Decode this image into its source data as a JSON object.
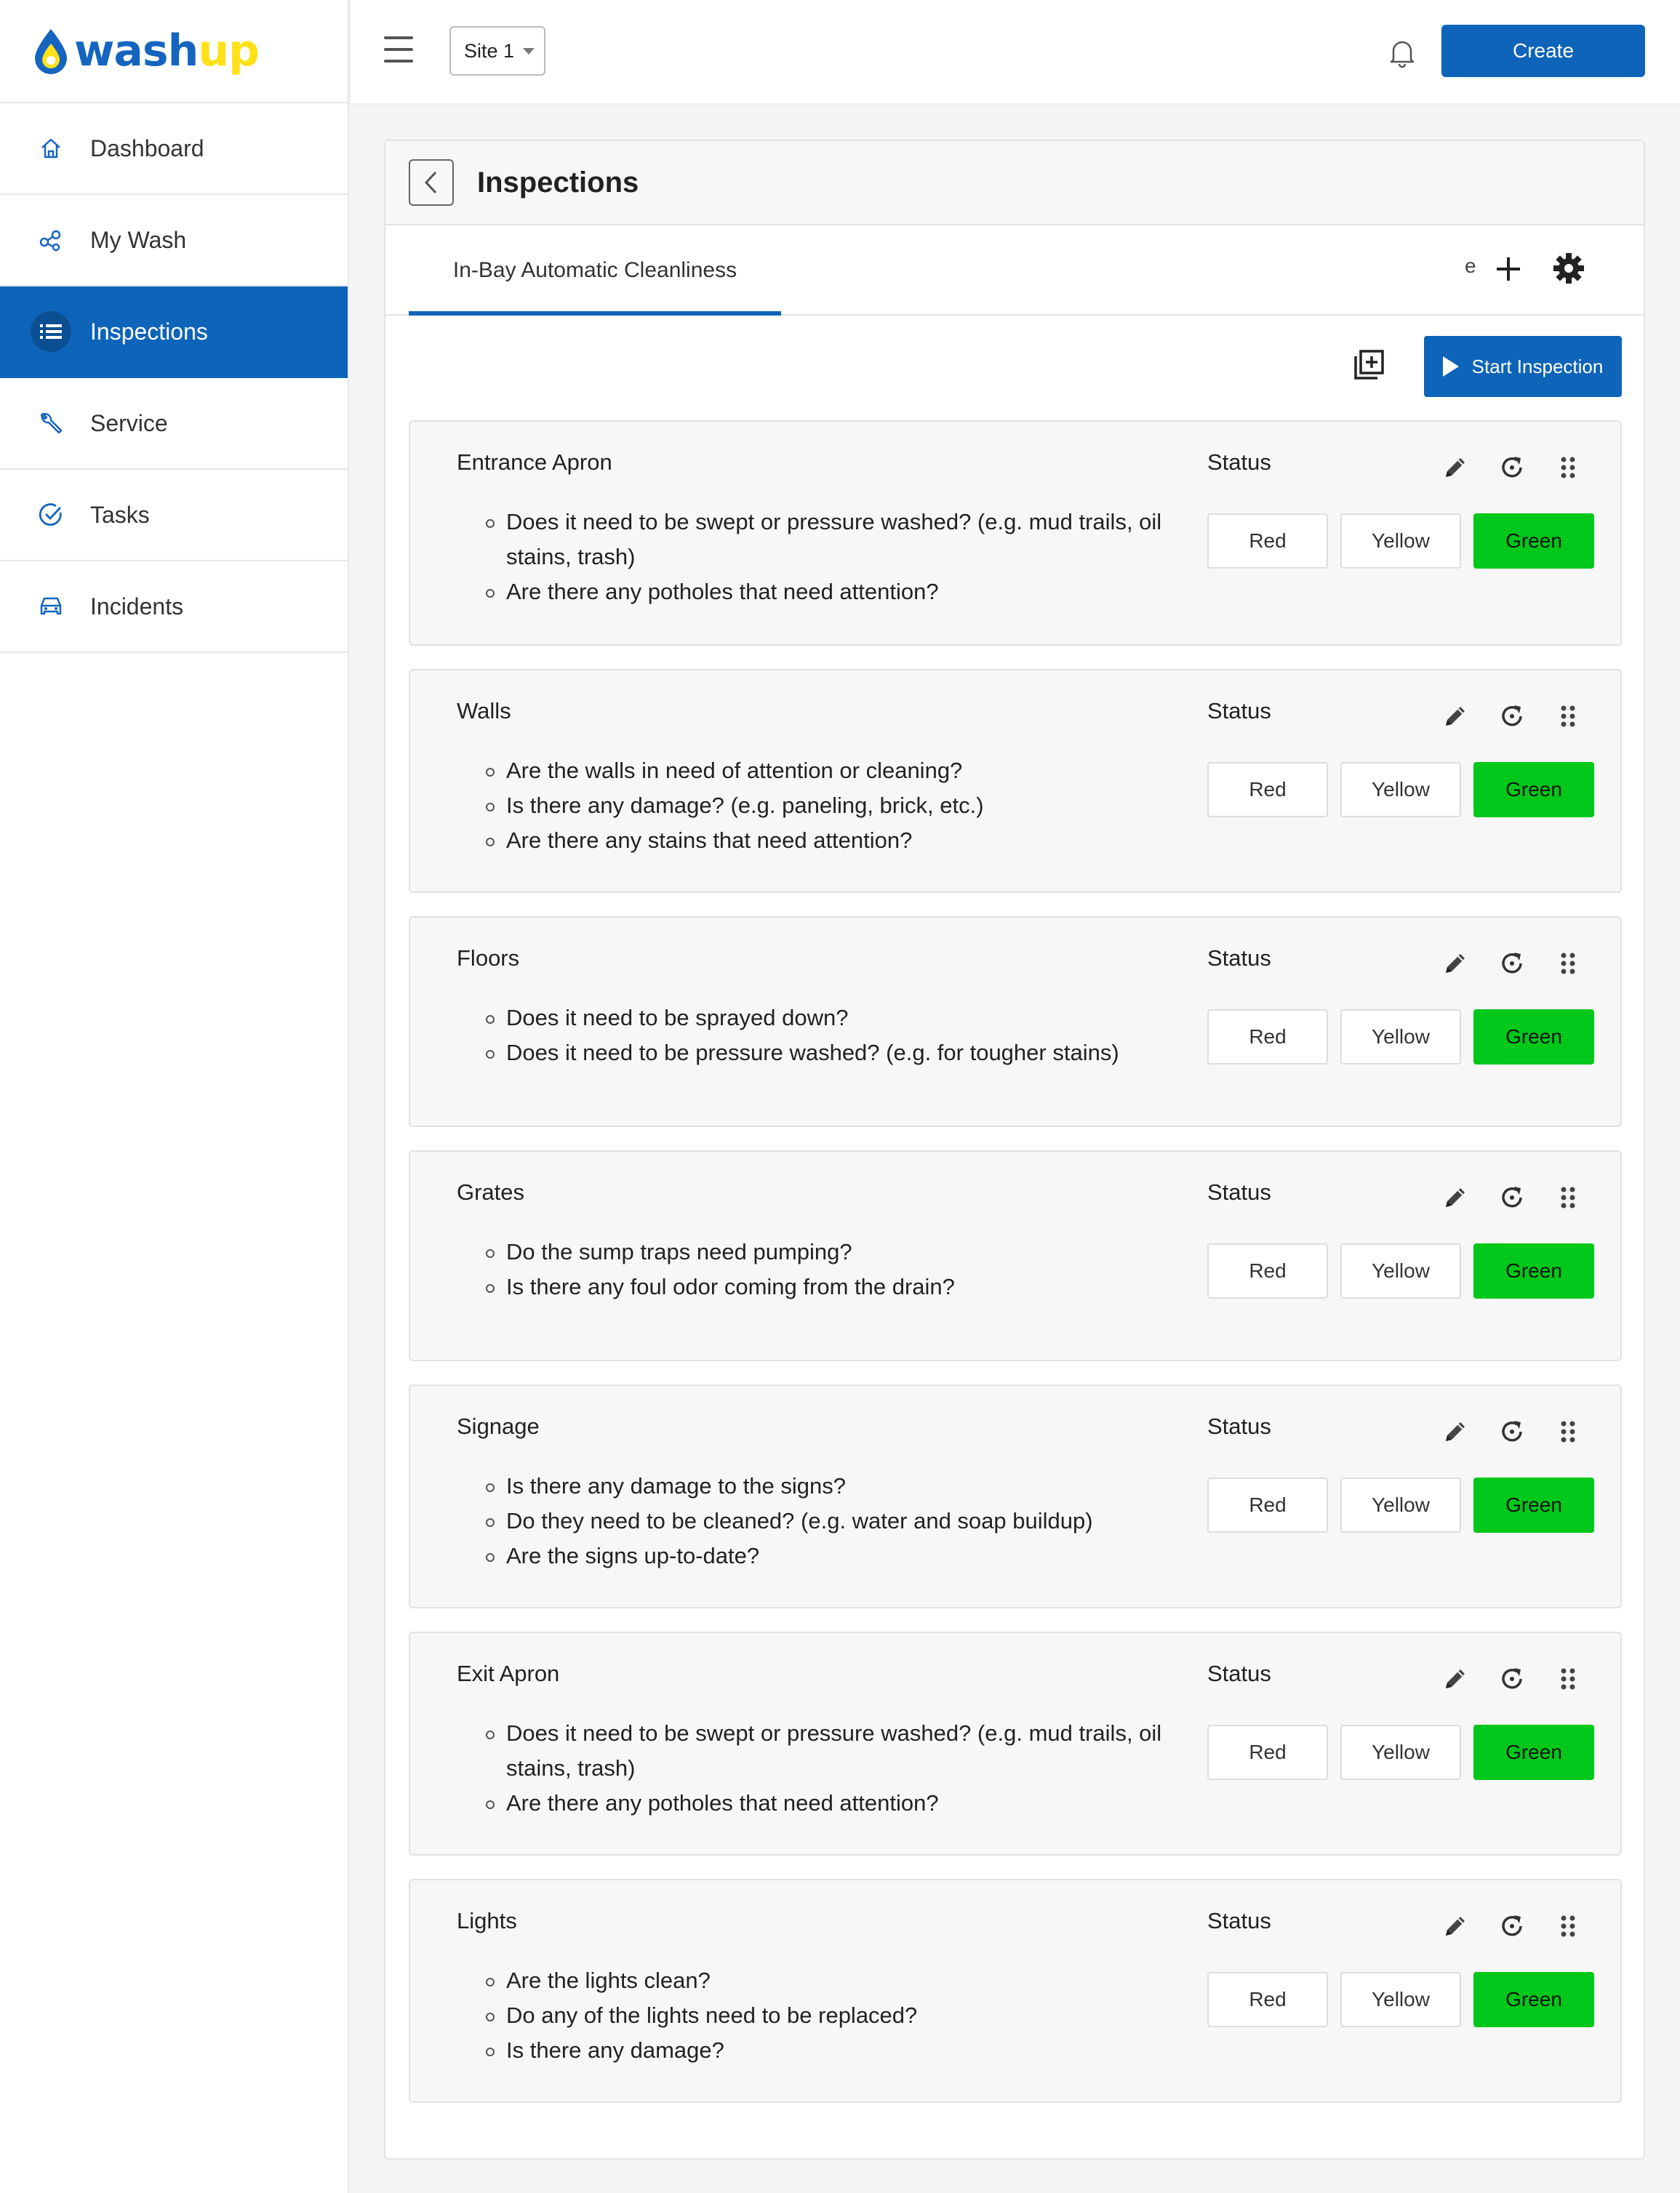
{
  "brand": {
    "wordmark_wash": "wash",
    "wordmark_up": "up"
  },
  "sidebar": {
    "items": [
      {
        "label": "Dashboard",
        "icon": "home-icon",
        "active": false
      },
      {
        "label": "My Wash",
        "icon": "nodes-icon",
        "active": false
      },
      {
        "label": "Inspections",
        "icon": "list-icon",
        "active": true
      },
      {
        "label": "Service",
        "icon": "wrench-icon",
        "active": false
      },
      {
        "label": "Tasks",
        "icon": "check-circle-icon",
        "active": false
      },
      {
        "label": "Incidents",
        "icon": "car-icon",
        "active": false
      }
    ]
  },
  "topbar": {
    "site_select": "Site 1",
    "create_label": "Create"
  },
  "page": {
    "title": "Inspections",
    "tab_label": "In-Bay Automatic Cleanliness",
    "tab_overflow": "e",
    "start_label": "Start Inspection"
  },
  "status_label": "Status",
  "status_buttons": {
    "red": "Red",
    "yellow": "Yellow",
    "green": "Green"
  },
  "items": [
    {
      "title": "Entrance Apron",
      "selected": "Green",
      "questions": [
        "Does it need to be swept or pressure washed? (e.g. mud trails, oil stains, trash)",
        "Are there any potholes that need attention?"
      ]
    },
    {
      "title": "Walls",
      "selected": "Green",
      "questions": [
        "Are the walls in need of attention or cleaning?",
        "Is there any damage? (e.g. paneling, brick, etc.)",
        "Are there any stains that need attention?"
      ]
    },
    {
      "title": "Floors",
      "selected": "Green",
      "questions": [
        "Does it need to be sprayed down?",
        "Does it need to be pressure washed? (e.g. for tougher stains)"
      ]
    },
    {
      "title": "Grates",
      "selected": "Green",
      "questions": [
        "Do the sump traps need pumping?",
        "Is there any foul odor coming from the drain?"
      ]
    },
    {
      "title": "Signage",
      "selected": "Green",
      "questions": [
        "Is there any damage to the signs?",
        "Do they need to be cleaned? (e.g. water and soap buildup)",
        "Are the signs up-to-date?"
      ]
    },
    {
      "title": "Exit Apron",
      "selected": "Green",
      "questions": [
        "Does it need to be swept or pressure washed? (e.g. mud trails, oil stains, trash)",
        "Are there any potholes that need attention?"
      ]
    },
    {
      "title": "Lights",
      "selected": "Green",
      "questions": [
        "Are the lights clean?",
        "Do any of the lights need to be replaced?",
        "Is there any damage?"
      ]
    }
  ],
  "colors": {
    "primary": "#0e64b8",
    "green_status": "#00c81a",
    "logo_yellow": "#ffe11a"
  }
}
